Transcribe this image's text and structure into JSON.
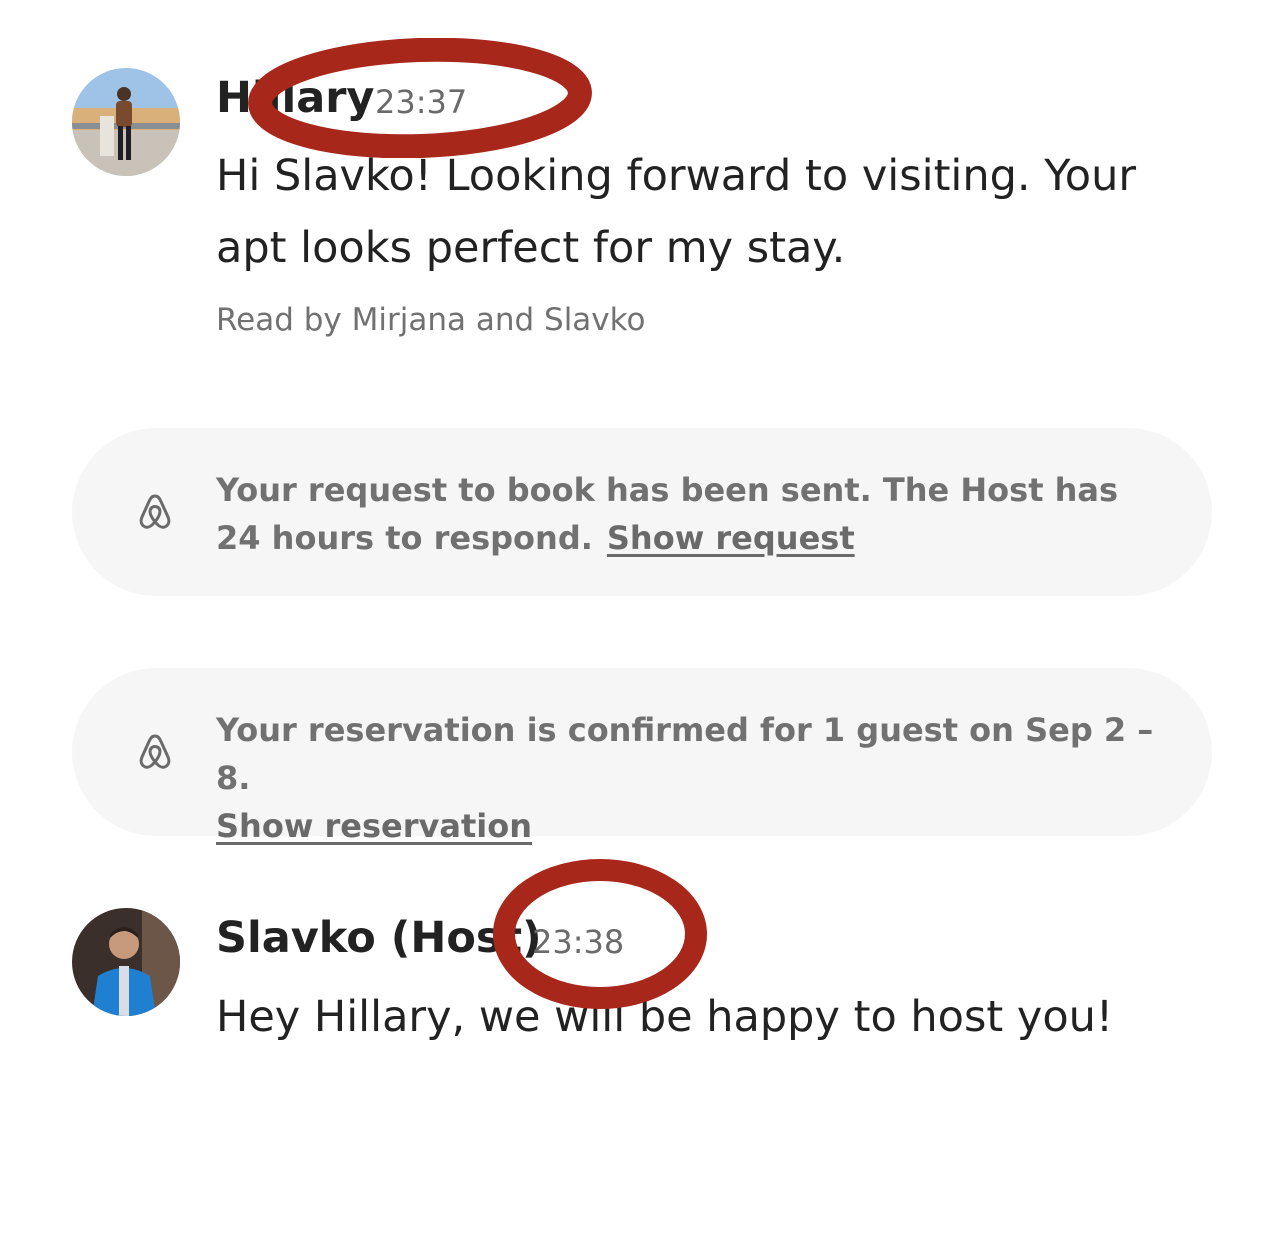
{
  "messages": [
    {
      "sender": "Hillary",
      "time": "23:37",
      "text": "Hi Slavko! Looking forward to visiting. Your apt looks perfect for my stay.",
      "read_receipt": "Read by Mirjana and Slavko"
    },
    {
      "sender": "Slavko (Host)",
      "time": "23:38",
      "text": "Hey Hillary, we will be happy to host you!"
    }
  ],
  "notices": [
    {
      "icon": "airbnb-logo-icon",
      "text": "Your request to book has been sent. The Host has 24 hours to respond.",
      "link": "Show request"
    },
    {
      "icon": "airbnb-logo-icon",
      "text": "Your reservation is confirmed for 1 guest on Sep 2 – 8.",
      "link": "Show reservation"
    }
  ],
  "colors": {
    "annotation": "#a8271b",
    "notice_background": "#f6f6f6",
    "secondary_text": "#6a6a6a"
  }
}
